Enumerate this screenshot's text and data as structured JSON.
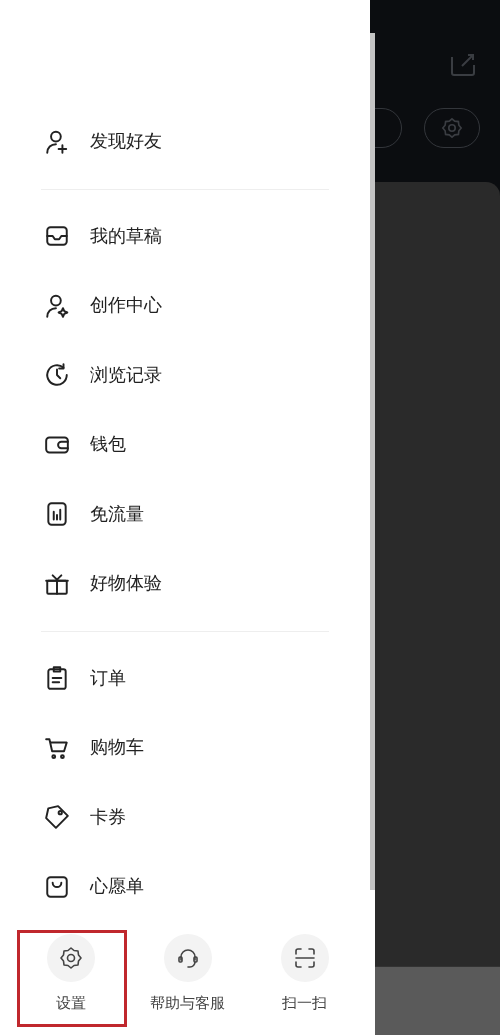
{
  "menu_groups": [
    {
      "items": [
        {
          "label": "发现好友"
        }
      ]
    },
    {
      "items": [
        {
          "label": "我的草稿"
        },
        {
          "label": "创作中心"
        },
        {
          "label": "浏览记录"
        },
        {
          "label": "钱包"
        },
        {
          "label": "免流量"
        },
        {
          "label": "好物体验"
        }
      ]
    },
    {
      "items": [
        {
          "label": "订单"
        },
        {
          "label": "购物车"
        },
        {
          "label": "卡券"
        },
        {
          "label": "心愿单"
        }
      ]
    }
  ],
  "bottom_actions": [
    {
      "label": "设置",
      "highlighted": true
    },
    {
      "label": "帮助与客服",
      "highlighted": false
    },
    {
      "label": "扫一扫",
      "highlighted": false
    }
  ]
}
